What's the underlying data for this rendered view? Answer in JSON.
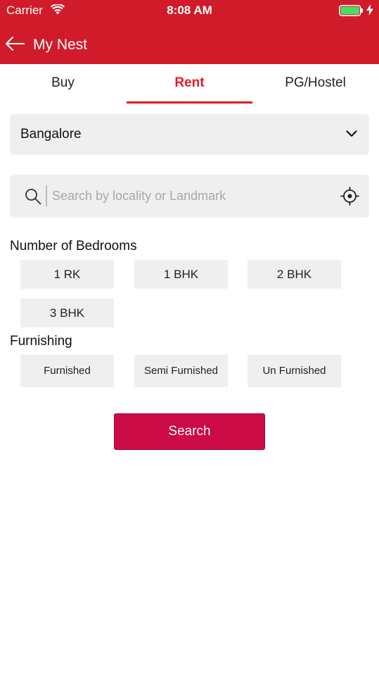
{
  "status_bar": {
    "carrier": "Carrier",
    "time": "8:08 AM",
    "icons": [
      "wifi-icon",
      "battery-icon",
      "charging-bolt-icon"
    ]
  },
  "nav": {
    "title": "My Nest",
    "back_icon": "back-arrow-icon",
    "color": "#d01b2a"
  },
  "tabs": {
    "items": [
      {
        "label": "Buy",
        "active": false
      },
      {
        "label": "Rent",
        "active": true
      },
      {
        "label": "PG/Hostel",
        "active": false
      }
    ],
    "active_color": "#e41b23"
  },
  "city_select": {
    "value": "Bangalore",
    "icon": "chevron-down-icon"
  },
  "search": {
    "placeholder": "Search by locality or Landmark",
    "icons": [
      "search-icon",
      "locate-icon"
    ]
  },
  "bedrooms": {
    "label": "Number of Bedrooms",
    "options": [
      "1 RK",
      "1 BHK",
      "2 BHK",
      "3 BHK"
    ]
  },
  "furnishing": {
    "label": "Furnishing",
    "options": [
      "Furnished",
      "Semi Furnished",
      "Un Furnished"
    ]
  },
  "search_button": {
    "label": "Search",
    "color": "#cc0a45"
  }
}
